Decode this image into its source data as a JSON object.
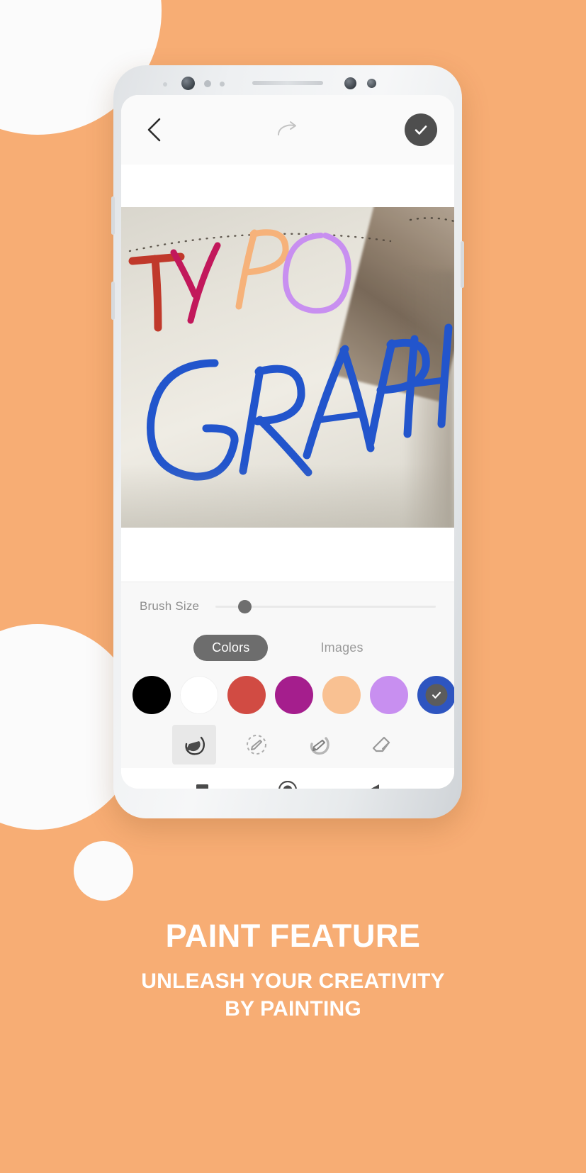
{
  "background": {
    "color": "#F7AD74",
    "circle_color": "#FBFBFB"
  },
  "toolbar": {
    "back_icon": "chevron-left-icon",
    "redo_icon": "redo-arrow-icon",
    "confirm_icon": "check-icon",
    "confirm_bg": "#4E4E4E"
  },
  "canvas": {
    "handwriting": [
      {
        "letter": "T",
        "color": "#C0392B"
      },
      {
        "letter": "Y",
        "color": "#C2185B"
      },
      {
        "letter": "P",
        "color": "#F6B27A"
      },
      {
        "letter": "O",
        "color": "#C88FF0"
      },
      {
        "letter": "G",
        "color": "#2255CC"
      },
      {
        "letter": "R",
        "color": "#2255CC"
      },
      {
        "letter": "A",
        "color": "#2255CC"
      },
      {
        "letter": "P",
        "color": "#2255CC"
      },
      {
        "letter": "H",
        "color": "#2255CC"
      }
    ],
    "dotted_guide": true
  },
  "tools": {
    "brush_size_label": "Brush Size",
    "brush_size_value": 8,
    "brush_size_min": 0,
    "brush_size_max": 100,
    "tabs": [
      {
        "label": "Colors",
        "active": true
      },
      {
        "label": "Images",
        "active": false
      }
    ],
    "colors": [
      {
        "name": "black",
        "hex": "#000000",
        "selected": false
      },
      {
        "name": "white",
        "hex": "#FFFFFF",
        "selected": false
      },
      {
        "name": "red",
        "hex": "#D14B43",
        "selected": false
      },
      {
        "name": "magenta",
        "hex": "#A51E8D",
        "selected": false
      },
      {
        "name": "peach",
        "hex": "#F9C192",
        "selected": false
      },
      {
        "name": "light-purple",
        "hex": "#C88FF0",
        "selected": false
      },
      {
        "name": "blue",
        "hex": "#2E55C0",
        "selected": true
      },
      {
        "name": "teal-blue",
        "hex": "#2284AE",
        "selected": false
      },
      {
        "name": "cyan",
        "hex": "#3EC1CC",
        "selected": false
      }
    ],
    "brushes": [
      {
        "name": "solid-brush",
        "selected": true
      },
      {
        "name": "dashed-brush",
        "selected": false
      },
      {
        "name": "soft-brush",
        "selected": false
      },
      {
        "name": "eraser",
        "selected": false
      }
    ]
  },
  "navbar": {
    "recents_icon": "square-icon",
    "home_icon": "circle-icon",
    "back_icon": "triangle-back-icon"
  },
  "promo": {
    "headline": "PAINT FEATURE",
    "subline_1": "UNLEASH YOUR CREATIVITY",
    "subline_2": "BY PAINTING"
  }
}
